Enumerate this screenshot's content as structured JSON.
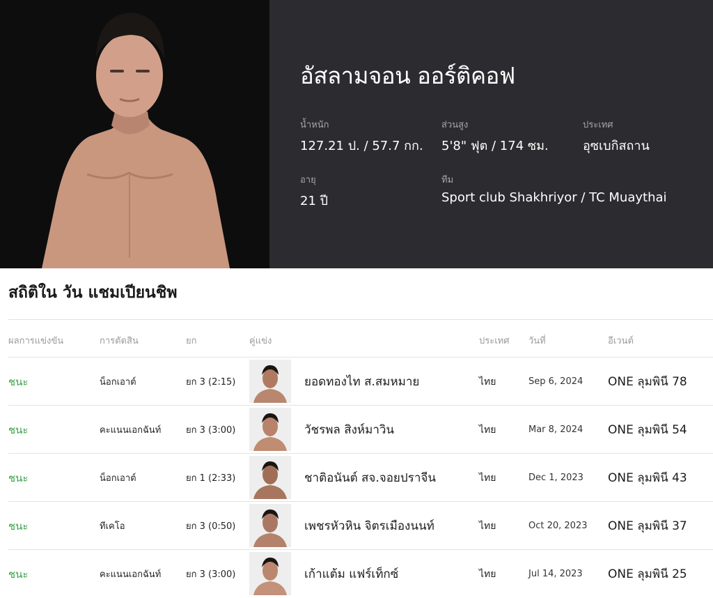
{
  "fighter": {
    "name": "อัสลามจอน ออร์ติคอฟ",
    "stats": [
      {
        "label": "น้ำหนัก",
        "value": "127.21 ป. / 57.7 กก."
      },
      {
        "label": "ส่วนสูง",
        "value": "5'8\" ฟุต / 174 ซม."
      },
      {
        "label": "ประเทศ",
        "value": "อุซเบกิสถาน"
      },
      {
        "label": "อายุ",
        "value": "21 ปี"
      },
      {
        "label": "ทีม",
        "value": "Sport club Shakhriyor / TC Muaythai"
      }
    ]
  },
  "record": {
    "title": "สถิติใน วัน แชมเปียนชิพ",
    "headers": [
      "ผลการแข่งขัน",
      "การตัดสิน",
      "ยก",
      "คู่แข่ง",
      "ประเทศ",
      "วันที่",
      "อีเวนต์"
    ],
    "rows": [
      {
        "result": "ชนะ",
        "method": "น็อกเอาต์",
        "round": "ยก 3 (2:15)",
        "opponent": "ยอดทองไท ส.สมหมาย",
        "country": "ไทย",
        "date": "Sep 6, 2024",
        "event": "ONE ลุมพินี 78"
      },
      {
        "result": "ชนะ",
        "method": "คะแนนเอกฉันท์",
        "round": "ยก 3 (3:00)",
        "opponent": "วัชรพล สิงห์มาวิน",
        "country": "ไทย",
        "date": "Mar 8, 2024",
        "event": "ONE ลุมพินี 54"
      },
      {
        "result": "ชนะ",
        "method": "น็อกเอาต์",
        "round": "ยก 1 (2:33)",
        "opponent": "ชาติอนันต์ สจ.จอยปราจีน",
        "country": "ไทย",
        "date": "Dec 1, 2023",
        "event": "ONE ลุมพินี 43"
      },
      {
        "result": "ชนะ",
        "method": "ทีเคโอ",
        "round": "ยก 3 (0:50)",
        "opponent": "เพชรหัวหิน จิตรเมืองนนท์",
        "country": "ไทย",
        "date": "Oct 20, 2023",
        "event": "ONE ลุมพินี 37"
      },
      {
        "result": "ชนะ",
        "method": "คะแนนเอกฉันท์",
        "round": "ยก 3 (3:00)",
        "opponent": "เก้าแต้ม แฟร์เท็กซ์",
        "country": "ไทย",
        "date": "Jul 14, 2023",
        "event": "ONE ลุมพินี 25"
      }
    ]
  }
}
